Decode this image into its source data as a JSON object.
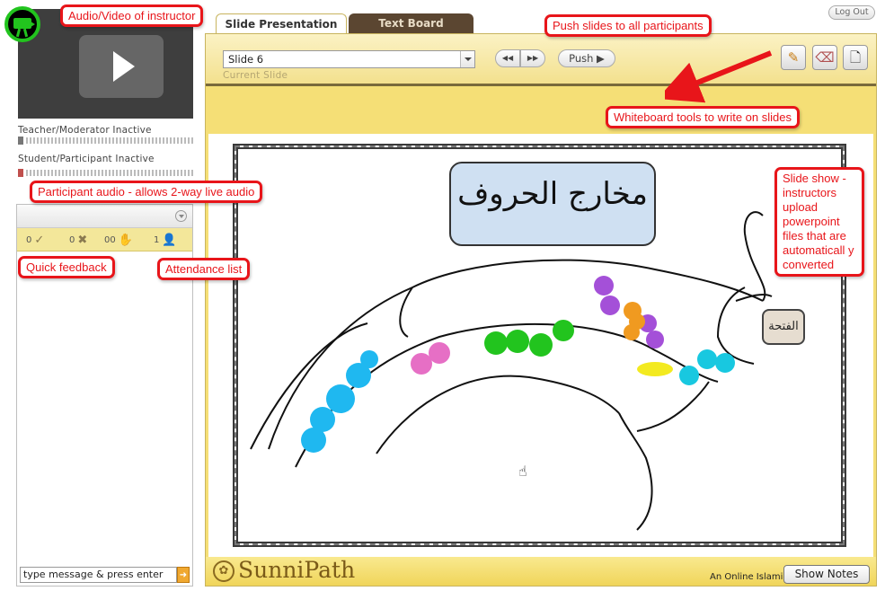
{
  "video": {
    "status_teacher": "Teacher/Moderator Inactive",
    "status_student": "Student/Participant Inactive"
  },
  "feedback": {
    "items": [
      {
        "count": "0",
        "icon": "check-icon",
        "glyph": "✓"
      },
      {
        "count": "0",
        "icon": "x-icon",
        "glyph": "✖"
      },
      {
        "count": "00",
        "icon": "raise-hand-icon",
        "glyph": "✋"
      },
      {
        "count": "1",
        "icon": "user-icon",
        "glyph": "👤"
      }
    ]
  },
  "chat": {
    "value": "type message & press enter",
    "send_glyph": "➜"
  },
  "tabs": [
    {
      "label": "Slide Presentation"
    },
    {
      "label": "Text Board"
    }
  ],
  "header": {
    "logout_label": "Log Out"
  },
  "toolbar": {
    "slide_value": "Slide 6",
    "current_label": "Current Slide",
    "prev_glyph": "◀◀",
    "next_glyph": "▶▶",
    "push_label": "Push ▶",
    "tool_pencil_glyph": "✎",
    "tool_eraser_glyph": "⌫",
    "tool_page_glyph": "🗋"
  },
  "slide": {
    "title": "مخارج الحروف",
    "mouth_label": "الفتحة"
  },
  "footer": {
    "brand": "SunniPath",
    "tagline": "An Online Islamic",
    "show_notes": "Show Notes",
    "brand_glyph": "✿"
  },
  "callouts": {
    "video": "Audio/Video of instructor",
    "push": "Push slides to all participants",
    "whiteboard": "Whiteboard tools to write on slides",
    "audio": "Participant audio - allows 2-way live audio",
    "feedback": "Quick feedback",
    "attendance": "Attendance list",
    "slideshow": "Slide show - instructors upload powerpoint files that are automaticall y converted"
  },
  "colors": {
    "accent_red": "#e8151a",
    "toolbar_yellow": "#f3e08c",
    "tab_dark": "#5b4631",
    "camera_green": "#22c41e"
  }
}
